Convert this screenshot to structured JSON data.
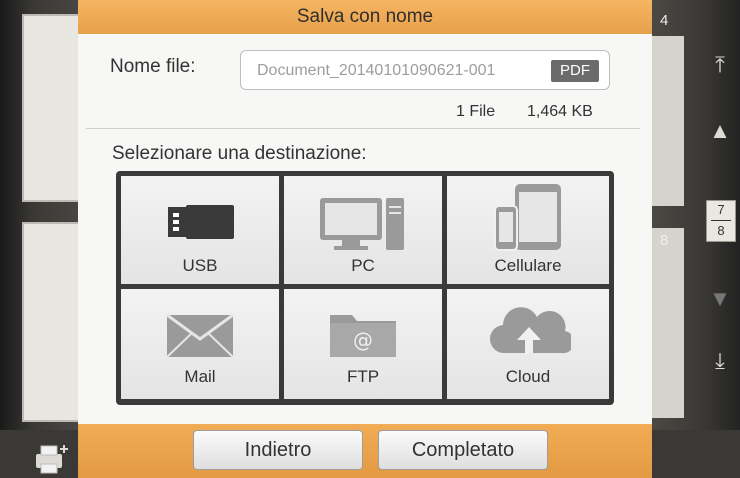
{
  "dialog": {
    "title": "Salva con nome",
    "file_name_label": "Nome file:",
    "file_name_value": "Document_20140101090621-001",
    "format_badge": "PDF",
    "file_count": "1 File",
    "file_size": "1,464 KB",
    "destination_label": "Selezionare una destinazione:",
    "destinations": [
      {
        "label": "USB",
        "icon": "usb-icon"
      },
      {
        "label": "PC",
        "icon": "pc-icon"
      },
      {
        "label": "Cellulare",
        "icon": "mobile-icon"
      },
      {
        "label": "Mail",
        "icon": "mail-icon"
      },
      {
        "label": "FTP",
        "icon": "ftp-folder-icon"
      },
      {
        "label": "Cloud",
        "icon": "cloud-upload-icon"
      }
    ],
    "back_label": "Indietro",
    "done_label": "Completato"
  },
  "background": {
    "page_indicator_current": "7",
    "page_indicator_total": "8",
    "right_thumb_numbers": [
      "4",
      "8"
    ]
  },
  "colors": {
    "accent_orange": "#eba24b",
    "grid_border": "#3a3a3a",
    "icon_gray": "#9a9a9a"
  }
}
